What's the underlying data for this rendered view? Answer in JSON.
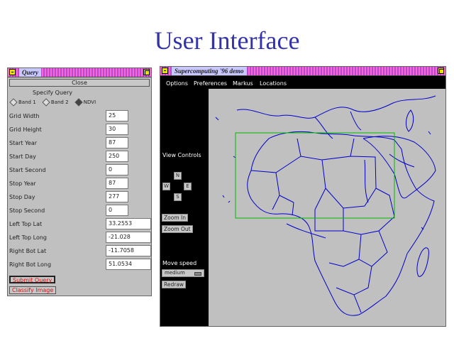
{
  "slide": {
    "title": "User Interface"
  },
  "query_window": {
    "title": "Query",
    "close_label": "Close",
    "specify_label": "Specify Query",
    "radios": [
      {
        "label": "Band 1",
        "selected": false
      },
      {
        "label": "Band 2",
        "selected": false
      },
      {
        "label": "NDVI",
        "selected": true
      }
    ],
    "fields": [
      {
        "label": "Grid Width",
        "value": "25"
      },
      {
        "label": "Grid Height",
        "value": "30"
      },
      {
        "label": "Start Year",
        "value": "87"
      },
      {
        "label": "Start Day",
        "value": "250"
      },
      {
        "label": "Start Second",
        "value": "0"
      },
      {
        "label": "Stop Year",
        "value": "87"
      },
      {
        "label": "Stop Day",
        "value": "277"
      },
      {
        "label": "Stop Second",
        "value": "0"
      },
      {
        "label": "Left Top Lat",
        "value": "33.2553"
      },
      {
        "label": "Left Top Long",
        "value": "-21.028"
      },
      {
        "label": "Right Bot Lat",
        "value": "-11.7058"
      },
      {
        "label": "Right Bot Long",
        "value": "51.0534"
      }
    ],
    "submit_label": "Submit Query",
    "classify_label": "Classify Image"
  },
  "sc_window": {
    "title": "Supercomputing '96 demo",
    "menu": [
      "Options",
      "Preferences",
      "Markus",
      "Locations"
    ],
    "view_controls_label": "View Controls",
    "arrows": {
      "n": "N",
      "w": "W",
      "e": "E",
      "s": "S"
    },
    "zoom_in_label": "Zoom In",
    "zoom_out_label": "Zoom Out",
    "move_speed_label": "Move speed",
    "move_speed_value": "medium",
    "redraw_label": "Redraw"
  },
  "colors": {
    "title": "#3333aa",
    "map_lines": "#0000cc",
    "selection_box": "#00bb00",
    "button_text": "#dd1111"
  }
}
